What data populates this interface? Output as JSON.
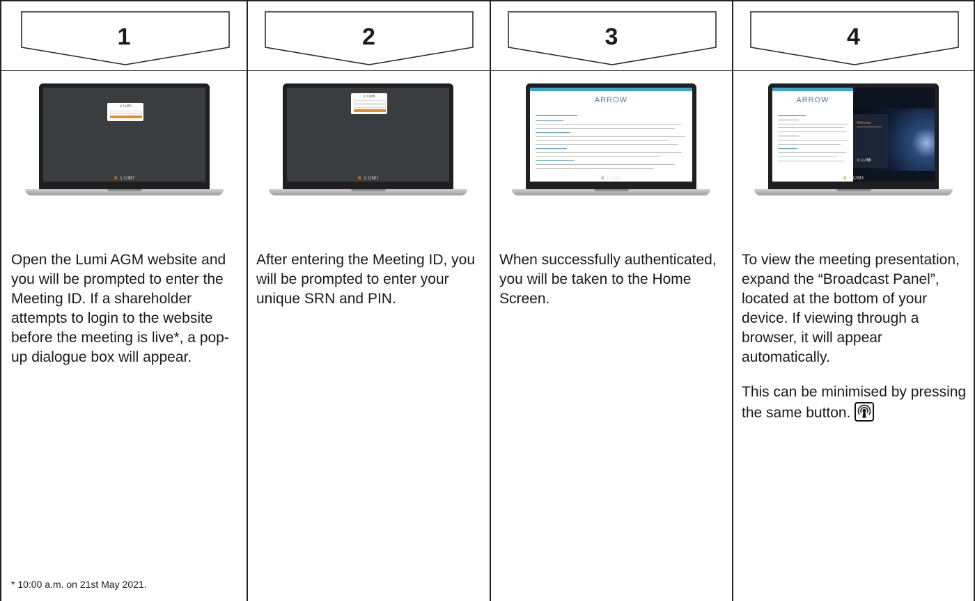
{
  "steps": [
    {
      "number": "1",
      "text": "Open the Lumi AGM website and you will be prompted to enter the Meeting ID. If a shareholder attempts to login to the website before the meeting is live*, a pop-up dialogue box will appear.",
      "screen": "lumi-dialog-meeting-id"
    },
    {
      "number": "2",
      "text": "After entering the Meeting ID, you will be prompted to enter your unique SRN and PIN.",
      "screen": "lumi-dialog-srn-pin"
    },
    {
      "number": "3",
      "text": "When successfully authenticated, you will be taken to the Home Screen.",
      "screen": "home-screen"
    },
    {
      "number": "4",
      "text": "To view the meeting presentation, expand the “Broadcast Panel”, located at the bottom of your device. If viewing through a browser, it will appear automatically.",
      "text2": "This can be minimised by pressing the same button.",
      "screen": "broadcast-panel",
      "icon": "broadcast-icon"
    }
  ],
  "footnote": "* 10:00 a.m. on 21st May 2021.",
  "laptop_brand": "LUMI",
  "home_logo": "ARROW",
  "colors": {
    "accent": "#f28c1e",
    "border": "#222222"
  }
}
